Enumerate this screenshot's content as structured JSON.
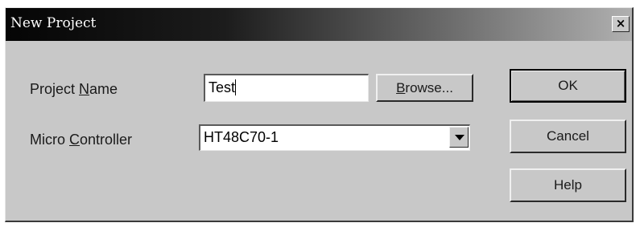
{
  "window": {
    "title": "New Project",
    "close_glyph": "×"
  },
  "form": {
    "project_name": {
      "label_before": "Project ",
      "label_mnemonic": "N",
      "label_after": "ame",
      "value": "Test"
    },
    "micro_controller": {
      "label_before": "Micro ",
      "label_mnemonic": "C",
      "label_after": "ontroller",
      "selected": "HT48C70-1"
    }
  },
  "buttons": {
    "browse": {
      "mnemonic": "B",
      "rest": "rowse..."
    },
    "ok": "OK",
    "cancel": "Cancel",
    "help": "Help"
  },
  "icons": {
    "close": "close-icon",
    "dropdown": "chevron-down-icon"
  }
}
